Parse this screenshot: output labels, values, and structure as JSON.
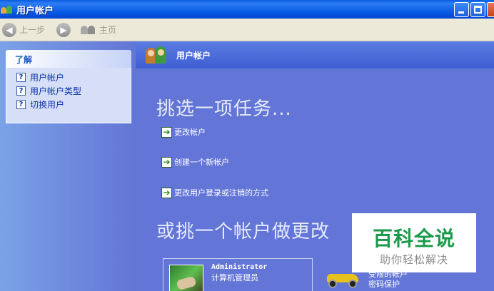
{
  "window": {
    "title": "用户帐户"
  },
  "toolbar": {
    "back_label": "上一步",
    "home_label": "主页"
  },
  "sidebar": {
    "panel_title": "了解",
    "items": [
      {
        "label": "用户帐户",
        "icon": "help-icon"
      },
      {
        "label": "用户帐户类型",
        "icon": "help-icon"
      },
      {
        "label": "切换用户",
        "icon": "help-icon"
      }
    ]
  },
  "main": {
    "header_title": "用户帐户",
    "pick_task_heading": "挑选一项任务...",
    "tasks": [
      {
        "label": "更改帐户",
        "icon": "green-arrow-icon"
      },
      {
        "label": "创建一个新帐户",
        "icon": "green-arrow-icon"
      },
      {
        "label": "更改用户登录或注销的方式",
        "icon": "green-arrow-icon"
      }
    ],
    "pick_account_heading": "或挑一个帐户做更改",
    "accounts": [
      {
        "name": "Administrator",
        "role": "计算机管理员"
      }
    ],
    "guest": {
      "line1": "受限的帐户",
      "line2": "密码保护"
    }
  },
  "watermark": {
    "title": "百科全说",
    "subtitle": "助你轻松解决"
  }
}
